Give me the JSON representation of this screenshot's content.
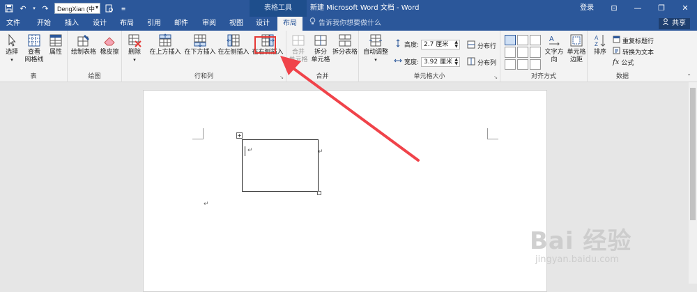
{
  "titlebar": {
    "font_selector": "DengXian (中",
    "tool_context": "表格工具",
    "document_title": "新建 Microsoft Word 文档 - Word",
    "login": "登录"
  },
  "tabs": [
    "文件",
    "开始",
    "插入",
    "设计",
    "布局",
    "引用",
    "邮件",
    "审阅",
    "视图",
    "设计",
    "布局"
  ],
  "active_tab_index": 10,
  "tell_me": "告诉我你想要做什么",
  "share": "共享",
  "ribbon": {
    "table_group": {
      "label": "表",
      "select": "选择",
      "gridlines_1": "查看",
      "gridlines_2": "网格线",
      "properties": "属性"
    },
    "draw_group": {
      "label": "绘图",
      "draw_table": "绘制表格",
      "eraser": "橡皮擦"
    },
    "rows_cols_group": {
      "label": "行和列",
      "delete": "删除",
      "insert_above": "在上方插入",
      "insert_below": "在下方插入",
      "insert_left": "在左侧插入",
      "insert_right": "在右侧插入"
    },
    "merge_group": {
      "label": "合并",
      "merge_1": "合并",
      "merge_2": "单元格",
      "split_cells_1": "拆分",
      "split_cells_2": "单元格",
      "split_table": "拆分表格"
    },
    "cell_size_group": {
      "label": "单元格大小",
      "autofit": "自动调整",
      "height_label": "高度:",
      "height_value": "2.7 厘米",
      "width_label": "宽度:",
      "width_value": "3.92 厘米",
      "distribute_rows": "分布行",
      "distribute_cols": "分布列"
    },
    "alignment_group": {
      "label": "对齐方式",
      "text_direction": "文字方向",
      "cell_margins_1": "单元格",
      "cell_margins_2": "边距"
    },
    "data_group": {
      "label": "数据",
      "sort": "排序",
      "repeat_header": "重复标题行",
      "convert_text": "转换为文本",
      "formula": "公式"
    }
  },
  "watermark": {
    "brand": "Bai 经验",
    "url": "jingyan.baidu.com"
  },
  "colors": {
    "titlebar": "#2b579a",
    "highlight": "#e53935",
    "arrow": "#f0434a"
  }
}
